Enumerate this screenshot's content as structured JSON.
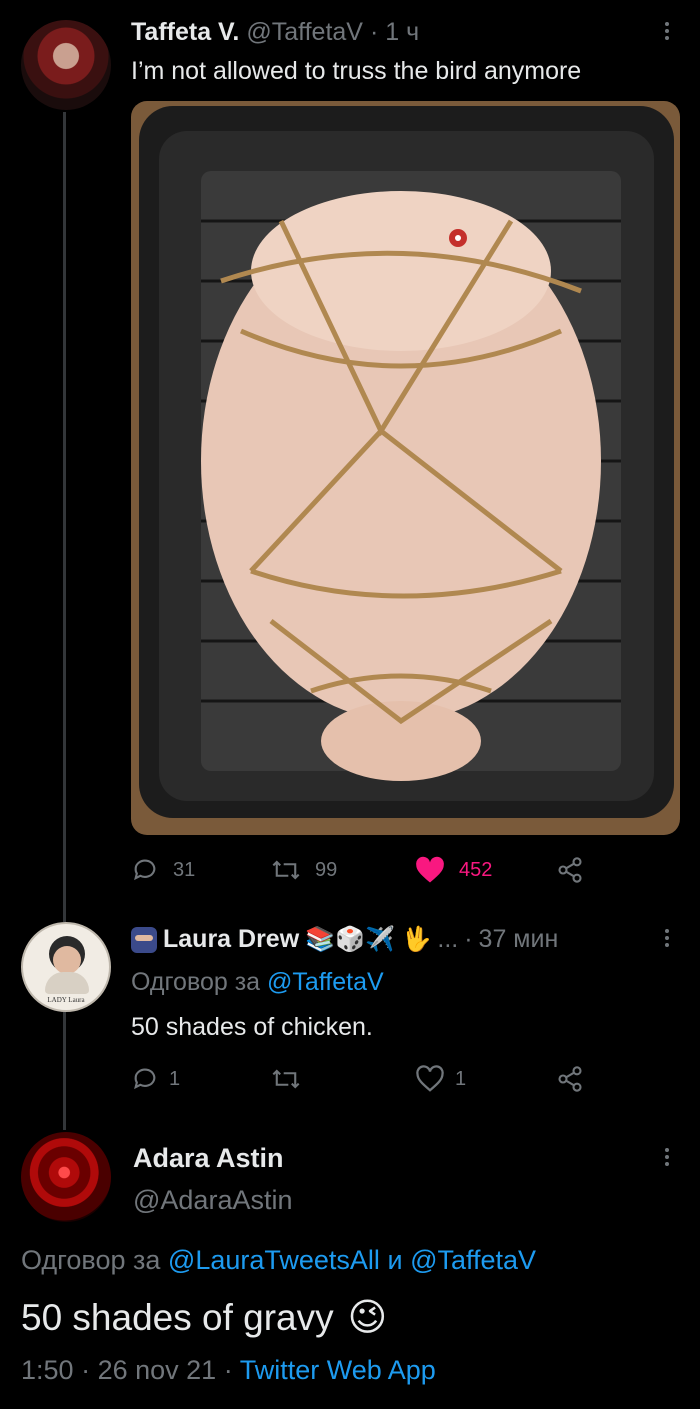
{
  "tweet1": {
    "display_name": "Taffeta V.",
    "handle": "@TaffetaV",
    "separator": "·",
    "time": "1 ч",
    "text": "I’m not allowed to truss the bird anymore",
    "stats": {
      "replies": "31",
      "retweets": "99",
      "likes": "452"
    }
  },
  "tweet2": {
    "display_name": "Laura Drew",
    "emoji": "📚🎲✈️ 🖖",
    "name_ellipsis": "...",
    "separator": "·",
    "time": "37 мин",
    "avatar_text": "LADY Laura",
    "reply_prefix": "Одговор за",
    "reply_to": "@TaffetaV",
    "text": "50 shades of chicken.",
    "stats": {
      "replies": "1",
      "retweets": "",
      "likes": "1"
    }
  },
  "tweet3": {
    "display_name": "Adara Astin",
    "handle": "@AdaraAstin",
    "reply_prefix": "Одговор за",
    "reply_to_1": "@LauraTweetsAll",
    "reply_conj": "и",
    "reply_to_2": "@TaffetaV",
    "text": "50 shades of gravy",
    "text_emoji": "😉",
    "time": "1:50",
    "date": "26 nov 21",
    "sep": "·",
    "source": "Twitter Web App"
  },
  "colors": {
    "background": "#000000",
    "text": "#e7e9ea",
    "muted": "#71767b",
    "link": "#1d9bf0",
    "like_active": "#f91880"
  },
  "icons": [
    "reply-icon",
    "retweet-icon",
    "heart-filled-icon",
    "heart-icon",
    "share-icon",
    "more-icon"
  ]
}
